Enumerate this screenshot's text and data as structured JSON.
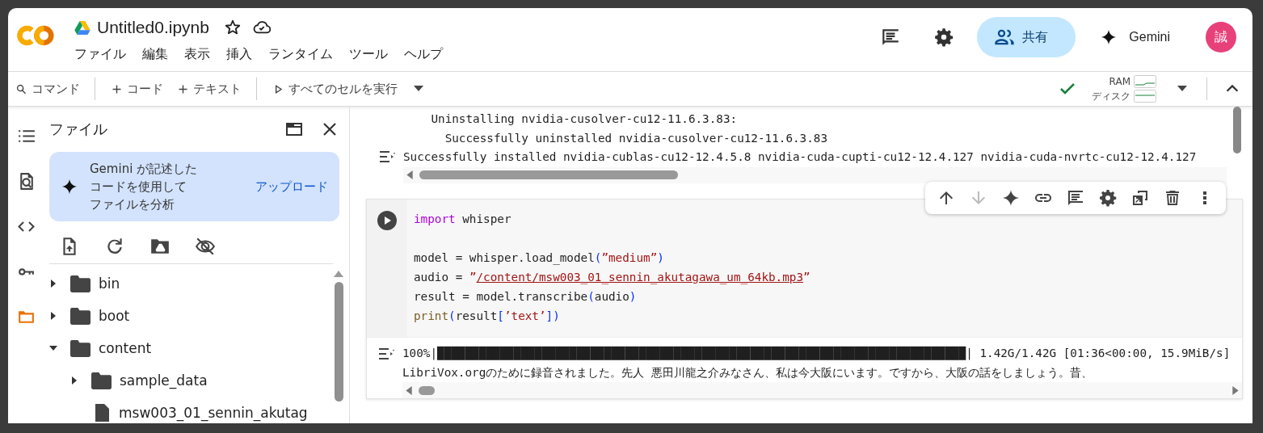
{
  "header": {
    "title": "Untitled0.ipynb",
    "menus": [
      "ファイル",
      "編集",
      "表示",
      "挿入",
      "ランタイム",
      "ツール",
      "ヘルプ"
    ],
    "share": "共有",
    "gemini": "Gemini",
    "avatar": "誠"
  },
  "toolbar": {
    "command": "コマンド",
    "add_code": "コード",
    "add_text": "テキスト",
    "run_all": "すべてのセルを実行",
    "ram": "RAM",
    "disk": "ディスク"
  },
  "rail": [
    {
      "kind": "toc",
      "selected": false
    },
    {
      "kind": "search",
      "selected": false
    },
    {
      "kind": "code",
      "selected": false
    },
    {
      "kind": "key",
      "selected": false
    },
    {
      "kind": "folder",
      "selected": true
    }
  ],
  "files": {
    "title": "ファイル",
    "gemini_card": {
      "lines": [
        "Gemini が記述した",
        "コードを使用して",
        "ファイルを分析"
      ],
      "link": "アップロード"
    },
    "tree": [
      {
        "name": "bin",
        "kind": "folder",
        "expanded": false
      },
      {
        "name": "boot",
        "kind": "folder",
        "expanded": false
      },
      {
        "name": "content",
        "kind": "folder",
        "expanded": true,
        "children": [
          {
            "name": "sample_data",
            "kind": "folder",
            "expanded": false
          },
          {
            "name": "msw003_01_sennin_akutag",
            "kind": "file"
          }
        ]
      }
    ]
  },
  "output_1": {
    "lines": [
      "    Uninstalling nvidia-cusolver-cu12-11.6.3.83:",
      "      Successfully uninstalled nvidia-cusolver-cu12-11.6.3.83",
      "Successfully installed nvidia-cublas-cu12-12.4.5.8 nvidia-cuda-cupti-cu12-12.4.127 nvidia-cuda-nvrtc-cu12-12.4.127"
    ]
  },
  "cell": {
    "code": [
      {
        "blank_before": false,
        "tokens": [
          {
            "kind": "keyword",
            "text": "import"
          },
          {
            "kind": "plain",
            "text": " whisper"
          }
        ]
      },
      {
        "blank_before": true,
        "tokens": [
          {
            "kind": "plain",
            "text": "model = whisper.load_model"
          },
          {
            "kind": "bracket",
            "text": "("
          },
          {
            "kind": "string",
            "text": "”medium”"
          },
          {
            "kind": "bracket",
            "text": ")"
          }
        ]
      },
      {
        "blank_before": false,
        "tokens": [
          {
            "kind": "plain",
            "text": "audio = "
          },
          {
            "kind": "string",
            "text": "”"
          },
          {
            "kind": "link",
            "text": "/content/msw003_01_sennin_akutagawa_um_64kb.mp3"
          },
          {
            "kind": "string",
            "text": "”"
          }
        ]
      },
      {
        "blank_before": false,
        "tokens": [
          {
            "kind": "plain",
            "text": "result = model.transcribe"
          },
          {
            "kind": "bracket",
            "text": "("
          },
          {
            "kind": "plain",
            "text": "audio"
          },
          {
            "kind": "bracket",
            "text": ")"
          }
        ]
      },
      {
        "blank_before": false,
        "tokens": [
          {
            "kind": "builtin",
            "text": "print"
          },
          {
            "kind": "bracket",
            "text": "("
          },
          {
            "kind": "plain",
            "text": "result"
          },
          {
            "kind": "bracket",
            "text": "["
          },
          {
            "kind": "string",
            "text": "’text’"
          },
          {
            "kind": "bracket",
            "text": "])"
          }
        ]
      }
    ],
    "toolbar": [
      {
        "kind": "up",
        "disabled": false
      },
      {
        "kind": "down",
        "disabled": true
      },
      {
        "kind": "sparkle",
        "disabled": false
      },
      {
        "kind": "link",
        "disabled": false
      },
      {
        "kind": "comment",
        "disabled": false
      },
      {
        "kind": "settings",
        "disabled": false
      },
      {
        "kind": "mirror",
        "disabled": false
      },
      {
        "kind": "delete",
        "disabled": false
      },
      {
        "kind": "more",
        "disabled": false
      }
    ],
    "output": {
      "progress_prefix": "100%|",
      "progress_bar": "████████████████████████████████████████████████████████████████████████████",
      "progress_suffix": "| 1.42G/1.42G [01:36<00:00, 15.9MiB/s]",
      "text": "LibriVox.orgのために録音されました。先人 悪田川龍之介みなさん、私は今大阪にいます。ですから、大阪の話をしましょう。昔、"
    }
  }
}
